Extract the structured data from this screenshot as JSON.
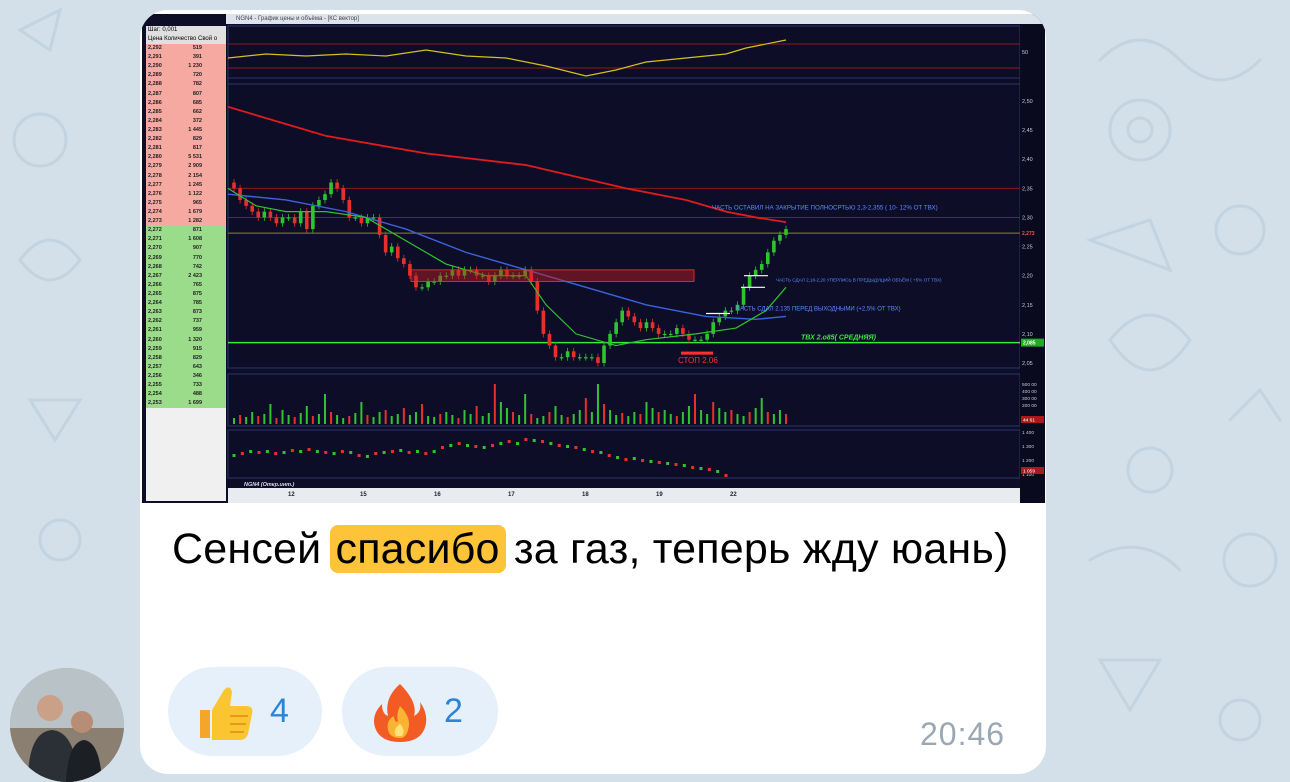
{
  "message": {
    "text_before": "Сенсей ",
    "highlight": "спасибо",
    "text_after": " за газ, теперь жду юань)",
    "time": "20:46",
    "highlight_color": "#fdc43a"
  },
  "reactions": [
    {
      "emoji": "thumbs-up-icon",
      "count": "4"
    },
    {
      "emoji": "fire-icon",
      "count": "2"
    }
  ],
  "screenshot": {
    "window_title": "NGN4 - График цены и объёма - [КС вектор]",
    "dom_header": "Цена  Количество  Свой о",
    "step_label": "Шаг: 0,001",
    "dom_rows_ask": [
      [
        "2,292",
        "519"
      ],
      [
        "2,291",
        "391"
      ],
      [
        "2,290",
        "1 230"
      ],
      [
        "2,289",
        "720"
      ],
      [
        "2,288",
        "782"
      ],
      [
        "2,287",
        "807"
      ],
      [
        "2,286",
        "685"
      ],
      [
        "2,285",
        "662"
      ],
      [
        "2,284",
        "372"
      ],
      [
        "2,283",
        "1 445"
      ],
      [
        "2,282",
        "829"
      ],
      [
        "2,281",
        "817"
      ],
      [
        "2,280",
        "5 531"
      ],
      [
        "2,279",
        "2 909"
      ],
      [
        "2,278",
        "2 154"
      ],
      [
        "2,277",
        "1 245"
      ],
      [
        "2,276",
        "1 122"
      ],
      [
        "2,275",
        "965"
      ],
      [
        "2,274",
        "1 679"
      ],
      [
        "2,273",
        "1 282"
      ]
    ],
    "dom_rows_bid": [
      [
        "2,272",
        "871"
      ],
      [
        "2,271",
        "1 608"
      ],
      [
        "2,270",
        "907"
      ],
      [
        "2,269",
        "770"
      ],
      [
        "2,268",
        "742"
      ],
      [
        "2,267",
        "2 423"
      ],
      [
        "2,266",
        "765"
      ],
      [
        "2,265",
        "875"
      ],
      [
        "2,264",
        "785"
      ],
      [
        "2,263",
        "873"
      ],
      [
        "2,262",
        "737"
      ],
      [
        "2,261",
        "959"
      ],
      [
        "2,260",
        "1 320"
      ],
      [
        "2,259",
        "915"
      ],
      [
        "2,258",
        "829"
      ],
      [
        "2,257",
        "643"
      ],
      [
        "2,256",
        "346"
      ],
      [
        "2,255",
        "733"
      ],
      [
        "2,254",
        "488"
      ],
      [
        "2,253",
        "1 699"
      ]
    ],
    "annotations": [
      "ЧАСТЬ ОСТАВИЛ НА ЗАКРЫТИЕ ПОЛНОСРТЬЮ 2,3-2,355 ( 10- 12% ОТ ТВХ)",
      "ЧАСТЬ СДАЛ 2,18-2,20 УПЕРЛИСЬ В ПРЕДЫДУЩИЙ ОБЪЁМ ( +5% ОТ ТВХ)",
      "ЧАСТЬ СДАЛ 2.135 ПЕРЕД ВЫХОДНЫМИ (+2,5% ОТ ТВХ)",
      "ТВХ 2.о85( СРЕДНЯЯ)",
      "СТОП 2.06"
    ],
    "price_axis": [
      "2,50",
      "2,45",
      "2,40",
      "2,35",
      "2,30",
      "2,25",
      "2,20",
      "2,15",
      "2,10",
      "2,05"
    ],
    "price_tags": [
      "2,273",
      "2,085"
    ],
    "oscillator_axis": [
      "50"
    ],
    "volume_axis": [
      "500 00",
      "400 00",
      "300 00",
      "200 00"
    ],
    "volume_tag": "44 61",
    "oi_axis": [
      "1 400",
      "1 300",
      "1 200",
      "1 100"
    ],
    "oi_tag": "1 059",
    "oi_label": "NGN4 (Откр.инт.)",
    "dates": [
      "12",
      "15",
      "16",
      "17",
      "18",
      "19",
      "22"
    ],
    "colors": {
      "background": "#0d0d28",
      "bull": "#2fc42f",
      "bear": "#e8302a",
      "ma_red": "#e01c1c",
      "ma_blue": "#3a64dc",
      "ma_green": "#2fc42f",
      "annotation_blue": "#5a8cff",
      "annotation_green": "#38e83a",
      "annotation_red": "#ff3030"
    }
  }
}
